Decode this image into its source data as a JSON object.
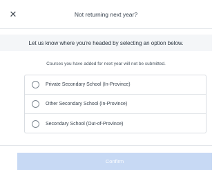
{
  "dialog": {
    "title": "Not returning next year?",
    "close_icon": "close-icon",
    "close_glyph": "✕"
  },
  "prompt": "Let us know where you're headed by selecting an option below.",
  "note": "Courses you have added for next year will not be submitted.",
  "options": [
    {
      "label": "Private Secondary School (In-Province)",
      "selected": false
    },
    {
      "label": "Other Secondary School (In-Province)",
      "selected": false
    },
    {
      "label": "Secondary School (Out-of-Province)",
      "selected": false
    }
  ],
  "confirm_label": "Confirm",
  "colors": {
    "confirm_bg": "#c7d9f4",
    "notice_bg": "#f4f6f8"
  }
}
